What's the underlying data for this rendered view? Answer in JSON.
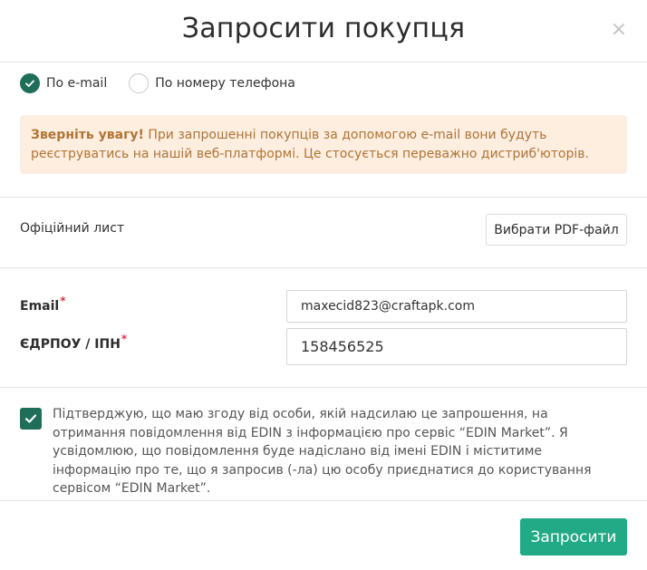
{
  "modal": {
    "title": "Запросити покупця",
    "close_label": "×"
  },
  "contact_method": {
    "options": [
      {
        "label": "По e-mail",
        "selected": true
      },
      {
        "label": "По номеру телефона",
        "selected": false
      }
    ]
  },
  "notice": {
    "bold": "Зверніть увагу!",
    "text": " При запрошенні покупців за допомогою e-mail вони будуть реєструватись на нашій веб-платформі. Це стосується переважно дистриб'юторів."
  },
  "official_letter": {
    "label": "Офіційний лист",
    "button_label": "Вибрати PDF-файл"
  },
  "fields": {
    "email": {
      "label": "Email",
      "required_mark": "*",
      "value": "maxecid823@craftapk.com"
    },
    "edrpou": {
      "label": "ЄДРПОУ / ІПН",
      "required_mark": "*",
      "value": "158456525"
    }
  },
  "consent": {
    "checked": true,
    "text": "Підтверджую, що маю згоду від особи, якій надсилаю це запрошення, на отримання повідомлення від EDIN з інформацією про сервіс “EDIN Market”. Я усвідомлюю, що повідомлення буде надіслано від імені EDIN і міститиме інформацію про те, що я запросив (-ла) цю особу приєднатися до користування сервісом “EDIN Market”."
  },
  "footer": {
    "submit_label": "Запросити"
  },
  "colors": {
    "accent_dark": "#1f6e5a",
    "accent_button": "#22a985",
    "notice_bg": "#fdeee0",
    "notice_text": "#b07435",
    "required": "#d9363e"
  }
}
